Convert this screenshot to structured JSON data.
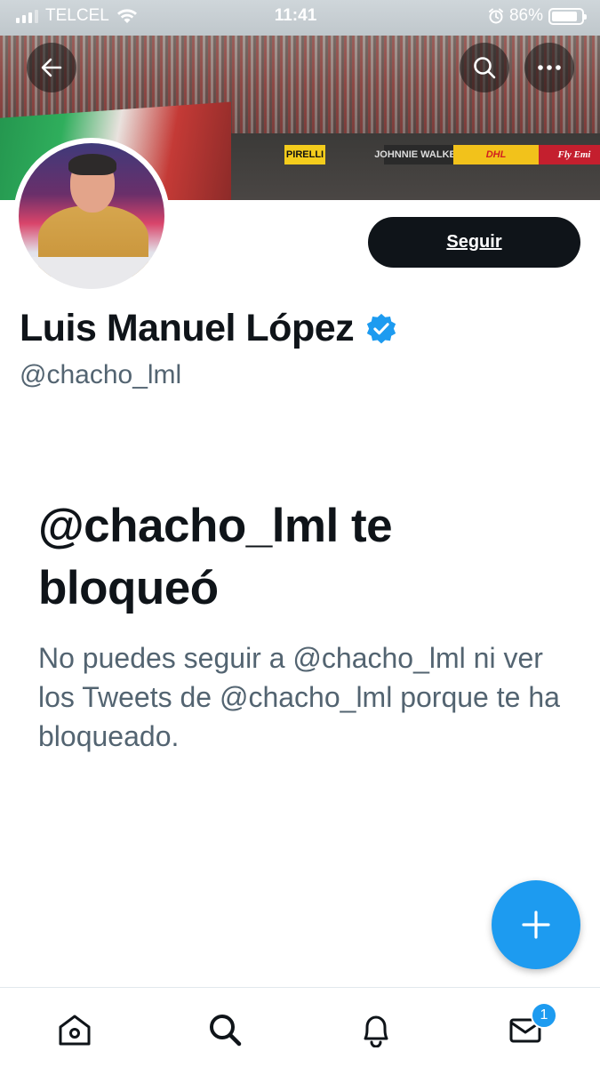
{
  "status_bar": {
    "carrier": "TELCEL",
    "time": "11:41",
    "battery_percent": "86%",
    "battery_level": 0.86
  },
  "banner": {
    "ads": {
      "dhl": "DHL",
      "fly": "Fly Emi",
      "pirelli": "PIRELLI",
      "walker": "JOHNNIE WALKER"
    }
  },
  "header": {
    "back_icon": "arrow-left-icon",
    "search_icon": "search-icon",
    "more_icon": "ellipsis-icon"
  },
  "profile": {
    "display_name": "Luis Manuel López",
    "handle": "@chacho_lml",
    "verified": true,
    "follow_label": "Seguir"
  },
  "blocked": {
    "title": "@chacho_lml te bloqueó",
    "message": "No puedes seguir a @chacho_lml ni ver los Tweets de @chacho_lml porque te ha bloqueado."
  },
  "compose": {
    "icon": "plus-icon"
  },
  "bottom_nav": {
    "items": [
      "home-icon",
      "search-icon",
      "bell-icon",
      "mail-icon"
    ],
    "messages_badge": "1"
  },
  "colors": {
    "accent": "#1d9bf0",
    "text_primary": "#0f1419",
    "text_secondary": "#536471"
  }
}
